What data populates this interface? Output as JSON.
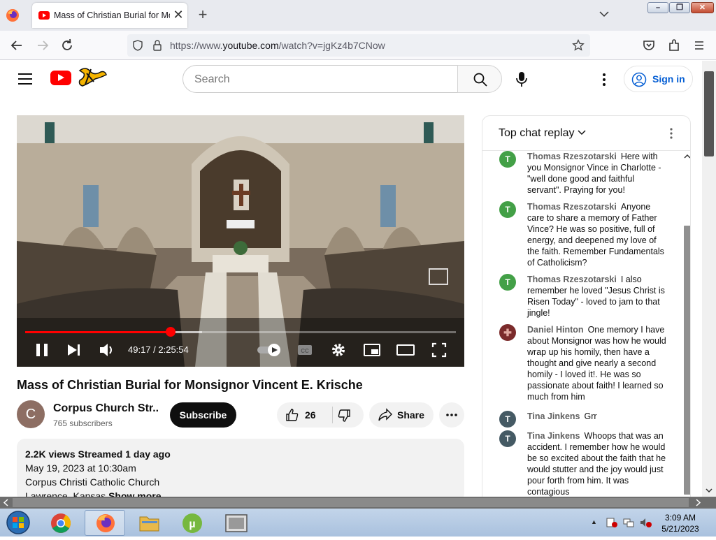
{
  "browser": {
    "tab_title": "Mass of Christian Burial for Monsignor",
    "url_prefix": "https://www.",
    "url_domain": "youtube.com",
    "url_path": "/watch?v=jgKz4b7CNow"
  },
  "header": {
    "search_placeholder": "Search",
    "sign_in": "Sign in"
  },
  "player": {
    "time": "49:17 / 2:25:54",
    "progress": 0.338,
    "buffered": 0.41
  },
  "video": {
    "title": "Mass of Christian Burial for Monsignor Vincent E. Krische",
    "channel_initial": "C",
    "channel_name": "Corpus Church Str...",
    "subscribers": "765 subscribers",
    "subscribe": "Subscribe",
    "likes": "26",
    "share": "Share"
  },
  "description": {
    "stats": "2.2K views  Streamed 1 day ago",
    "line1": "May 19, 2023 at 10:30am",
    "line2": "Corpus Christi Catholic Church",
    "line3": "Lawrence, Kansas",
    "show_more": "Show more"
  },
  "chat": {
    "title": "Top chat replay",
    "messages": [
      {
        "author": "Thomas Rzeszotarski",
        "initial": "T",
        "color": "#43a047",
        "text": "Here with you Monsignor Vince in Charlotte - \"well done good and faithful servant\". Praying for you!"
      },
      {
        "author": "Thomas Rzeszotarski",
        "initial": "T",
        "color": "#43a047",
        "text": "Anyone care to share a memory of Father Vince? He was so positive, full of energy, and deepened my love of the faith. Remember Fundamentals of Catholicism?"
      },
      {
        "author": "Thomas Rzeszotarski",
        "initial": "T",
        "color": "#43a047",
        "text": "I also remember he loved \"Jesus Christ is Risen Today\" - loved to jam to that jingle!"
      },
      {
        "author": "Daniel Hinton",
        "initial": "",
        "color": "#7b2b2b",
        "text": "One memory I have about Monsignor was how he would wrap up his homily, then have a thought and give nearly a second homily - I loved it!. He was so passionate about faith! I learned so much from him"
      },
      {
        "author": "Tina Jinkens",
        "initial": "T",
        "color": "#455a64",
        "text": "Grr"
      },
      {
        "author": "Tina Jinkens",
        "initial": "T",
        "color": "#455a64",
        "text": "Whoops that was an accident. I remember how he would be so excited about the faith that he would stutter and the joy would just pour forth from him. It was contagious"
      }
    ]
  },
  "taskbar": {
    "time": "3:09 AM",
    "date": "5/21/2023"
  }
}
